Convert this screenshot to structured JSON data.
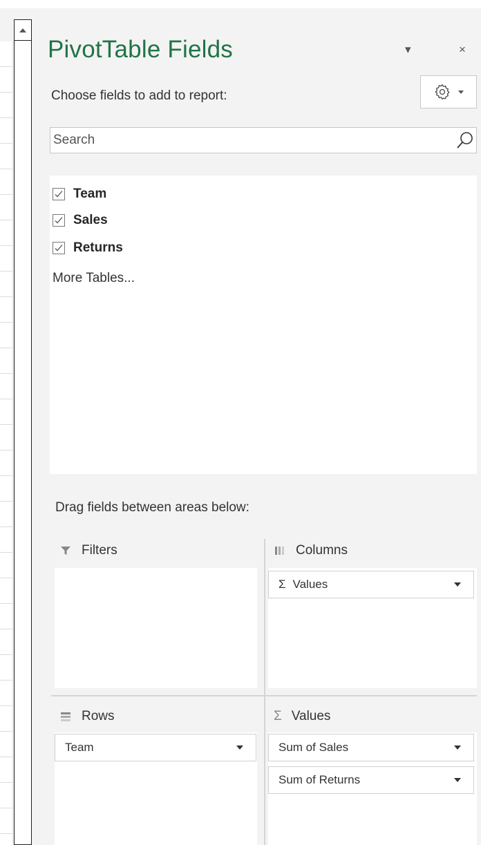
{
  "pane": {
    "title": "PivotTable Fields",
    "choose_label": "Choose fields to add to report:",
    "search_placeholder": "Search",
    "fields": [
      {
        "label": "Team",
        "checked": true
      },
      {
        "label": "Sales",
        "checked": true
      },
      {
        "label": "Returns",
        "checked": true
      }
    ],
    "more_tables": "More Tables...",
    "drag_label": "Drag fields between areas below:"
  },
  "areas": {
    "filters": {
      "label": "Filters",
      "items": []
    },
    "columns": {
      "label": "Columns",
      "items": [
        {
          "label": "Values",
          "symbol": "Σ"
        }
      ]
    },
    "rows": {
      "label": "Rows",
      "items": [
        {
          "label": "Team"
        }
      ]
    },
    "values": {
      "label": "Values",
      "symbol": "Σ",
      "items": [
        {
          "label": "Sum of Sales"
        },
        {
          "label": "Sum of Returns"
        }
      ]
    }
  },
  "colors": {
    "title_green": "#217346",
    "pane_bg": "#f3f3f3"
  },
  "icons": {
    "close": "×",
    "dropdown": "▾"
  }
}
